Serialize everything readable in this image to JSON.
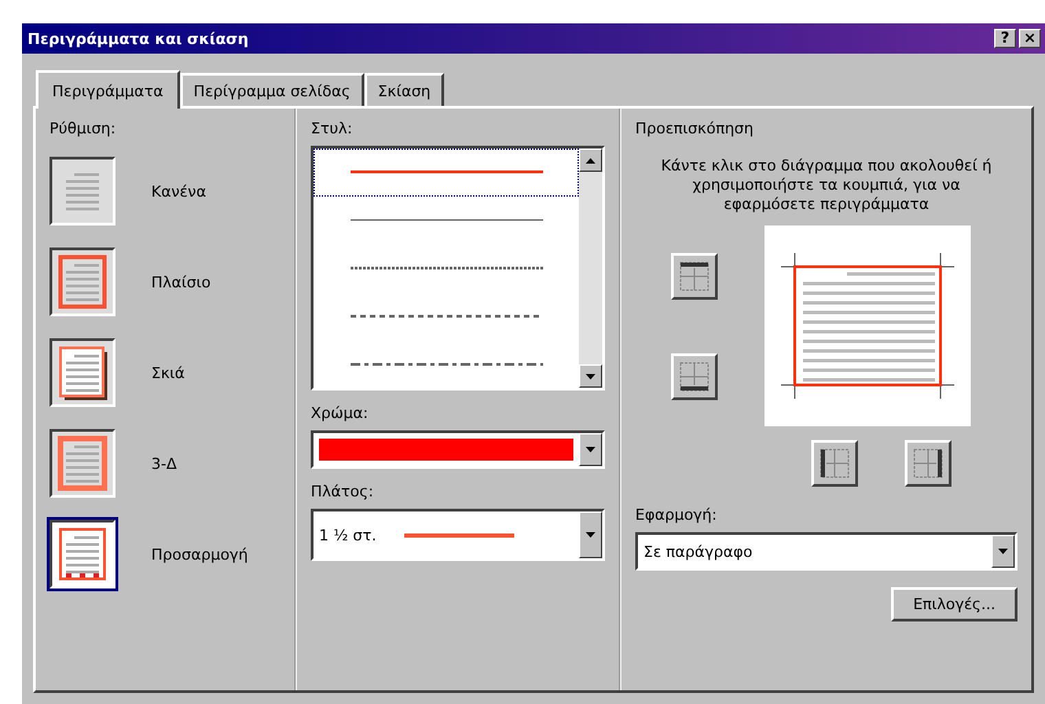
{
  "window": {
    "title": "Περιγράμματα και σκίαση",
    "help": "?",
    "close": "×"
  },
  "tabs": [
    {
      "label": "Περιγράμματα",
      "selected": true
    },
    {
      "label": "Περίγραμμα σελίδας",
      "selected": false
    },
    {
      "label": "Σκίαση",
      "selected": false
    }
  ],
  "setting": {
    "label": "Ρύθμιση:",
    "items": [
      {
        "label": "Κανένα",
        "kind": "none",
        "selected": false
      },
      {
        "label": "Πλαίσιο",
        "kind": "box",
        "selected": false
      },
      {
        "label": "Σκιά",
        "kind": "shadow",
        "selected": false
      },
      {
        "label": "3-Δ",
        "kind": "threed",
        "selected": false
      },
      {
        "label": "Προσαρμογή",
        "kind": "custom",
        "selected": true
      }
    ]
  },
  "style": {
    "label": "Στυλ:",
    "lines": [
      {
        "kind": "solid",
        "selected": true
      },
      {
        "kind": "thin",
        "selected": false
      },
      {
        "kind": "dotted",
        "selected": false
      },
      {
        "kind": "dashed",
        "selected": false
      },
      {
        "kind": "dashdot",
        "selected": false
      }
    ]
  },
  "color": {
    "label": "Χρώμα:",
    "color": "#ff0000"
  },
  "width": {
    "label": "Πλάτος:",
    "value": "1 ½ στ."
  },
  "preview": {
    "label": "Προεπισκόπηση",
    "hint": "Κάντε κλικ στο διάγραμμα που ακολουθεί ή χρησιμοποιήστε τα κουμπιά, για να εφαρμόσετε περιγράμματα"
  },
  "apply": {
    "label": "Εφαρμογή:",
    "value": "Σε παράγραφο"
  },
  "options_button": "Επιλογές..."
}
